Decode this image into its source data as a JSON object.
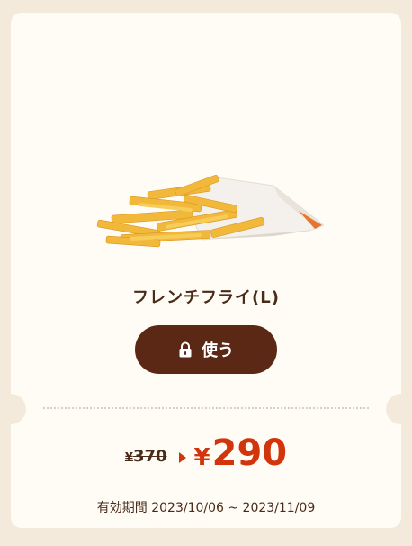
{
  "coupon": {
    "product_name": "フレンチフライ(L)",
    "use_button_label": "使う",
    "old_price_currency": "¥",
    "old_price": "370",
    "new_price_currency": "¥",
    "new_price": "290",
    "validity_label": "有効期間",
    "validity_range": "2023/10/06 ~ 2023/11/09"
  },
  "icons": {
    "lock": "lock-icon",
    "arrow": "triangle-right-icon"
  },
  "colors": {
    "background": "#f3eadc",
    "card": "#fffcf6",
    "button": "#5a2814",
    "price_accent": "#d2340b",
    "text": "#4a2a18"
  }
}
